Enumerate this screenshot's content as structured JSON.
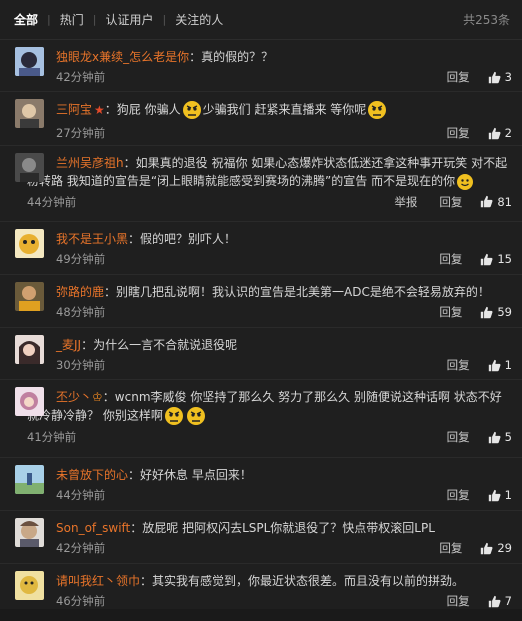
{
  "tabs": {
    "all": "全部",
    "hot": "热门",
    "verified": "认证用户",
    "following": "关注的人",
    "total": "共253条"
  },
  "actions": {
    "reply": "回复",
    "report": "举报"
  },
  "comments": [
    {
      "user": "独眼龙x兼续_怎么老是你",
      "colon": "：",
      "text": "真的假的？？",
      "time": "42分钟前",
      "likes": "3",
      "avatar_color": "#6a8fc0",
      "report": false
    },
    {
      "user": "三阿宝",
      "colon": "：",
      "text1": "狗屁 你骗人",
      "text2": "少骗我们 赶紧来直播来 等你呢",
      "time": "27分钟前",
      "likes": "2",
      "avatar_color": "#7a6a5a",
      "report": false
    },
    {
      "user": "兰州吴彦祖h",
      "colon": "：",
      "line1": "如果真的退役 祝福你  如果心态爆炸状态低迷还拿这种事开玩笑  对不起",
      "line2": "粉转路  我知道的宣告是“闭上眼睛就能感受到赛场的沸腾”的宣告 而不是现在的你",
      "time": "44分钟前",
      "likes": "81",
      "avatar_color": "#5a5a5a",
      "report": true
    },
    {
      "user": "我不是王小黑",
      "colon": "：",
      "text": "假的吧？别吓人！",
      "time": "49分钟前",
      "likes": "15",
      "avatar_color": "#e0b040",
      "report": false
    },
    {
      "user": "弥路的鹿",
      "colon": "：",
      "text": "别瞎几把乱说啊！我认识的宣告是北美第一ADC是绝不会轻易放弃的！",
      "time": "48分钟前",
      "likes": "59",
      "avatar_color": "#8a7040",
      "report": false
    },
    {
      "user": "_麦JJ",
      "colon": "：",
      "text": "为什么一言不合就说退役呢",
      "time": "30分钟前",
      "likes": "1",
      "avatar_color": "#c0a0a0",
      "report": false
    },
    {
      "user": "丕少丶",
      "colon": "：",
      "line1": "wcnm李威俊 你坚持了那么久 努力了那么久 别随便说这种话啊  状态不好",
      "line2": "就冷静冷静？ 你别这样啊",
      "time": "41分钟前",
      "likes": "5",
      "avatar_color": "#d0a0c0",
      "report": false
    },
    {
      "user": "未曾放下的心",
      "colon": "：",
      "text": "好好休息 早点回来！",
      "time": "44分钟前",
      "likes": "1",
      "avatar_color": "#60a0c0",
      "report": false
    },
    {
      "user": "Son_of_swift",
      "colon": "：",
      "text": "放屁呢  把阿权闪去LSPL你就退役了？快点带权滚回LPL",
      "time": "42分钟前",
      "likes": "29",
      "avatar_color": "#a09080",
      "report": false
    },
    {
      "user": "请叫我红丶领巾",
      "colon": "：",
      "text": "其实我有感觉到，你最近状态很差。而且没有以前的拼劲。",
      "time": "46分钟前",
      "likes": "7",
      "avatar_color": "#d0c060",
      "report": false
    }
  ],
  "colors": {
    "username": "#e8742a",
    "background": "#1f1f1f",
    "text": "#d6d6d6",
    "meta": "#9a9a9a"
  },
  "icons": [
    "thumbs-up-icon",
    "star-badge-icon",
    "angry-emoji-icon",
    "smile-emoji-icon"
  ]
}
